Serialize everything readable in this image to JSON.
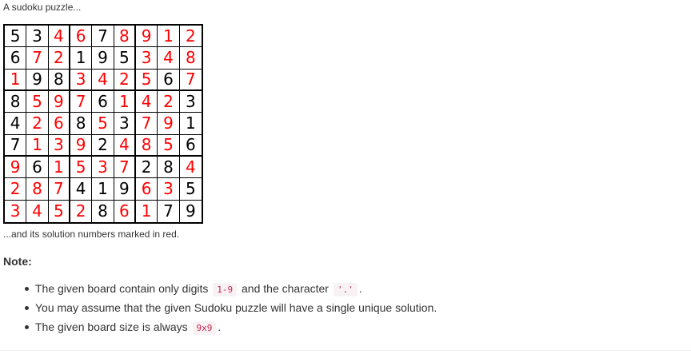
{
  "caption_top": "A sudoku puzzle...",
  "caption_bottom": "...and its solution numbers marked in red.",
  "note_heading": "Note:",
  "colors": {
    "given": "#000000",
    "solution": "#ff0000"
  },
  "sudoku": {
    "rows": [
      [
        "5",
        "3",
        "4",
        "6",
        "7",
        "8",
        "9",
        "1",
        "2"
      ],
      [
        "6",
        "7",
        "2",
        "1",
        "9",
        "5",
        "3",
        "4",
        "8"
      ],
      [
        "1",
        "9",
        "8",
        "3",
        "4",
        "2",
        "5",
        "6",
        "7"
      ],
      [
        "8",
        "5",
        "9",
        "7",
        "6",
        "1",
        "4",
        "2",
        "3"
      ],
      [
        "4",
        "2",
        "6",
        "8",
        "5",
        "3",
        "7",
        "9",
        "1"
      ],
      [
        "7",
        "1",
        "3",
        "9",
        "2",
        "4",
        "8",
        "5",
        "6"
      ],
      [
        "9",
        "6",
        "1",
        "5",
        "3",
        "7",
        "2",
        "8",
        "4"
      ],
      [
        "2",
        "8",
        "7",
        "4",
        "1",
        "9",
        "6",
        "3",
        "5"
      ],
      [
        "3",
        "4",
        "5",
        "2",
        "8",
        "6",
        "1",
        "7",
        "9"
      ]
    ],
    "solution_mask": [
      [
        0,
        0,
        1,
        1,
        0,
        1,
        1,
        1,
        1
      ],
      [
        0,
        1,
        1,
        0,
        0,
        0,
        1,
        1,
        1
      ],
      [
        1,
        0,
        0,
        1,
        1,
        1,
        1,
        0,
        1
      ],
      [
        0,
        1,
        1,
        1,
        0,
        1,
        1,
        1,
        0
      ],
      [
        0,
        1,
        1,
        0,
        1,
        0,
        1,
        1,
        0
      ],
      [
        0,
        1,
        1,
        1,
        0,
        1,
        1,
        1,
        0
      ],
      [
        1,
        0,
        1,
        1,
        1,
        1,
        0,
        0,
        1
      ],
      [
        1,
        1,
        1,
        0,
        0,
        0,
        1,
        1,
        0
      ],
      [
        1,
        1,
        1,
        1,
        0,
        1,
        1,
        0,
        0
      ]
    ]
  },
  "notes": [
    {
      "before": "The given board contain only digits",
      "code1": "1-9",
      "middle": "and the character",
      "code2": "'.'",
      "after": "."
    },
    {
      "text": "You may assume that the given Sudoku puzzle will have a single unique solution."
    },
    {
      "before": "The given board size is always",
      "code1": "9x9",
      "after": "."
    }
  ]
}
